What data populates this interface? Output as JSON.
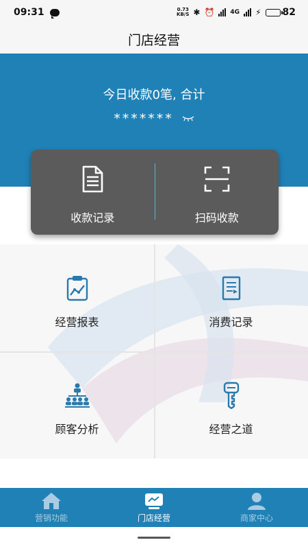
{
  "status_bar": {
    "time": "09:31",
    "net_speed_value": "0.73",
    "net_speed_unit": "KB/S",
    "network_type": "4G",
    "battery": "82",
    "battery_level": 0.82
  },
  "header": {
    "title": "门店经营"
  },
  "summary": {
    "text": "今日收款0笔, 合计",
    "amount_masked": "*******"
  },
  "actions": [
    {
      "label": "收款记录",
      "icon": "document-icon"
    },
    {
      "label": "扫码收款",
      "icon": "scan-icon"
    }
  ],
  "grid": [
    {
      "label": "经营报表",
      "icon": "chart-clipboard-icon"
    },
    {
      "label": "消费记录",
      "icon": "receipt-icon"
    },
    {
      "label": "顾客分析",
      "icon": "org-chart-icon"
    },
    {
      "label": "经营之道",
      "icon": "key-icon"
    }
  ],
  "bottom_nav": [
    {
      "label": "营销功能",
      "icon": "home-icon",
      "active": false
    },
    {
      "label": "门店经营",
      "icon": "monitor-chart-icon",
      "active": true
    },
    {
      "label": "商家中心",
      "icon": "user-icon",
      "active": false
    }
  ],
  "colors": {
    "primary_blue": "#2081b6",
    "card_gray": "#5b5b5b",
    "icon_blue": "#2a79ad",
    "nav_inactive": "#a9cce2"
  }
}
